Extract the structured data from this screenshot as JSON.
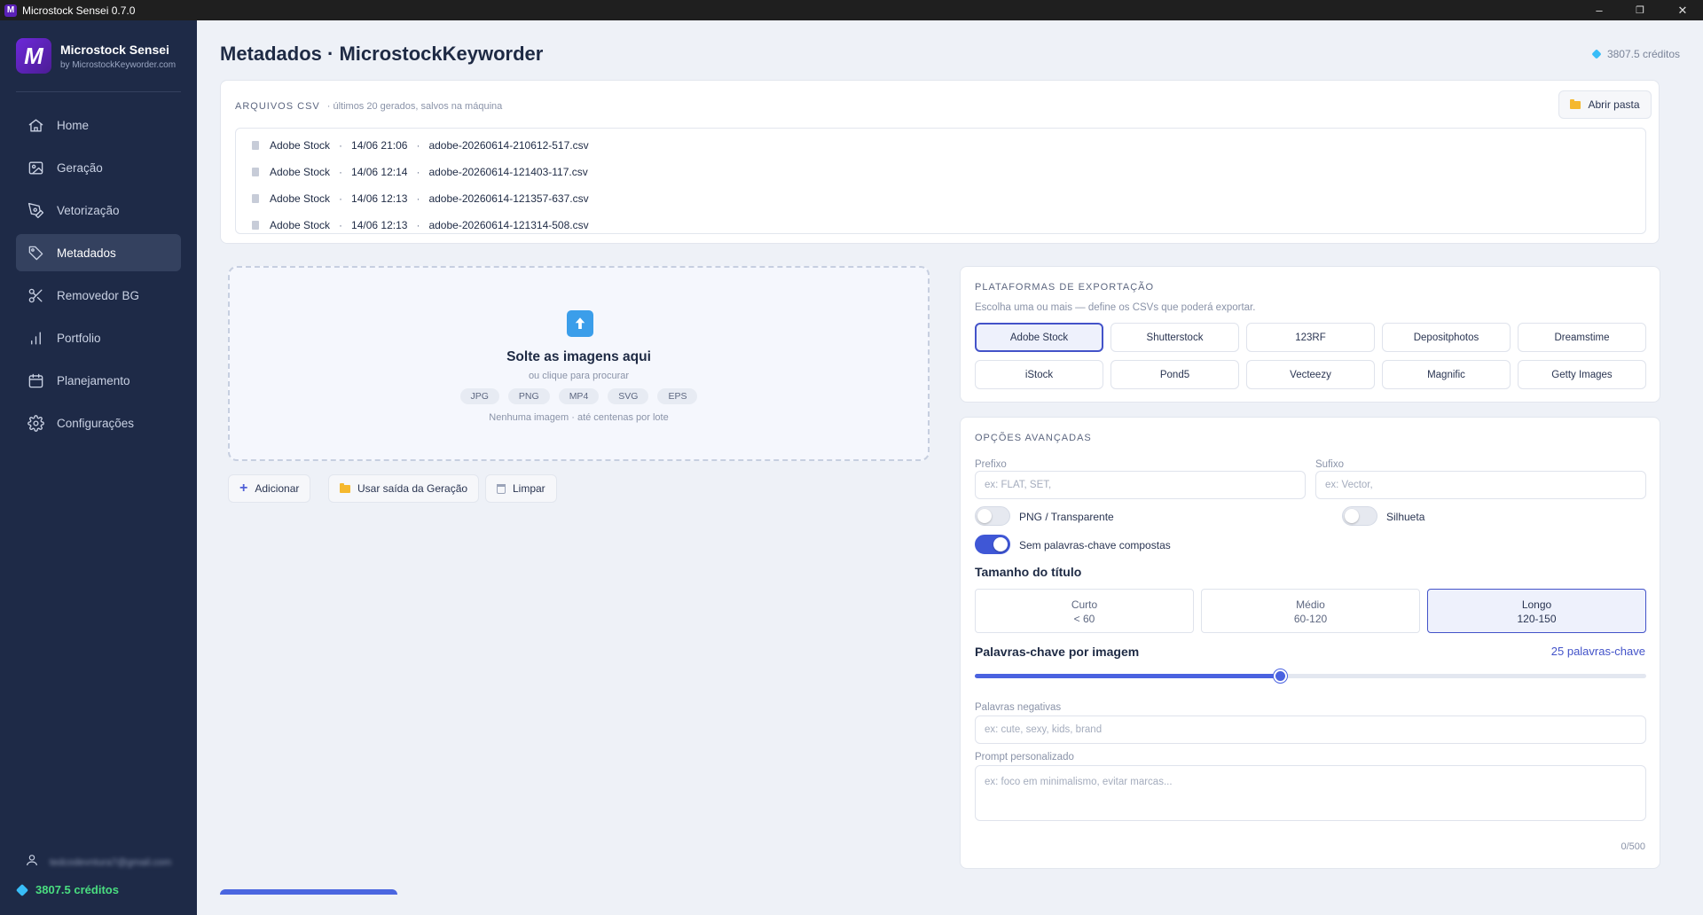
{
  "window": {
    "title": "Microstock Sensei 0.7.0",
    "logo_letter": "M",
    "minimize": "–",
    "restore": "❐",
    "close": "✕"
  },
  "sidebar": {
    "brand_name": "Microstock Sensei",
    "brand_sub": "by MicrostockKeyworder.com",
    "items": [
      {
        "label": "Home",
        "icon": "home-icon"
      },
      {
        "label": "Geração",
        "icon": "image-icon"
      },
      {
        "label": "Vetorização",
        "icon": "pen-icon"
      },
      {
        "label": "Metadados",
        "icon": "tag-icon",
        "active": true
      },
      {
        "label": "Removedor BG",
        "icon": "scissors-icon"
      },
      {
        "label": "Portfolio",
        "icon": "bar-chart-icon"
      },
      {
        "label": "Planejamento",
        "icon": "calendar-icon"
      },
      {
        "label": "Configurações",
        "icon": "gear-icon"
      }
    ],
    "user_email": "tedcodevntura7@gmail.com",
    "credits": "3807.5 créditos"
  },
  "header": {
    "title": "Metadados · MicrostockKeyworder",
    "credits": "3807.5 créditos"
  },
  "csv": {
    "label": "ARQUIVOS CSV",
    "hint": "· últimos 20 gerados, salvos na máquina",
    "open_folder": "Abrir pasta",
    "files": [
      {
        "platform": "Adobe Stock",
        "date": "14/06 21:06",
        "name": "adobe-20260614-210612-517.csv"
      },
      {
        "platform": "Adobe Stock",
        "date": "14/06 12:14",
        "name": "adobe-20260614-121403-117.csv"
      },
      {
        "platform": "Adobe Stock",
        "date": "14/06 12:13",
        "name": "adobe-20260614-121357-637.csv"
      },
      {
        "platform": "Adobe Stock",
        "date": "14/06 12:13",
        "name": "adobe-20260614-121314-508.csv"
      }
    ]
  },
  "dropzone": {
    "title": "Solte as imagens aqui",
    "subtitle": "ou clique para procurar",
    "formats": [
      "JPG",
      "PNG",
      "MP4",
      "SVG",
      "EPS"
    ],
    "note": "Nenhuma imagem · até centenas por lote"
  },
  "actions": {
    "add": "Adicionar",
    "use_generation": "Usar saída da Geração",
    "clear": "Limpar"
  },
  "platforms": {
    "label": "PLATAFORMAS DE EXPORTAÇÃO",
    "hint": "Escolha uma ou mais — define os CSVs que poderá exportar.",
    "options": [
      {
        "label": "Adobe Stock",
        "selected": true
      },
      {
        "label": "Shutterstock"
      },
      {
        "label": "123RF"
      },
      {
        "label": "Depositphotos"
      },
      {
        "label": "Dreamstime"
      },
      {
        "label": "iStock"
      },
      {
        "label": "Pond5"
      },
      {
        "label": "Vecteezy"
      },
      {
        "label": "Magnific"
      },
      {
        "label": "Getty Images"
      }
    ]
  },
  "advanced": {
    "label": "OPÇÕES AVANÇADAS",
    "prefix_label": "Prefixo",
    "prefix_placeholder": "ex: FLAT, SET,",
    "suffix_label": "Sufixo",
    "suffix_placeholder": "ex: Vector,",
    "png_label": "PNG / Transparente",
    "png_on": false,
    "silhouette_label": "Silhueta",
    "silhouette_on": false,
    "no_compound_label": "Sem palavras-chave compostas",
    "no_compound_on": true,
    "title_size_label": "Tamanho do título",
    "title_sizes": [
      {
        "name": "Curto",
        "range": "< 60"
      },
      {
        "name": "Médio",
        "range": "60-120"
      },
      {
        "name": "Longo",
        "range": "120-150",
        "selected": true
      }
    ],
    "keywords_label": "Palavras-chave por imagem",
    "keywords_value": "25 palavras-chave",
    "keywords_fraction": 0.455,
    "negative_label": "Palavras negativas",
    "negative_placeholder": "ex: cute, sexy, kids, brand",
    "prompt_label": "Prompt personalizado",
    "prompt_placeholder": "ex: foco em minimalismo, evitar marcas...",
    "prompt_counter": "0/500"
  },
  "colors": {
    "accent": "#4353c9",
    "sidebar_bg": "#1e2a47",
    "credits_green": "#4ade80"
  }
}
